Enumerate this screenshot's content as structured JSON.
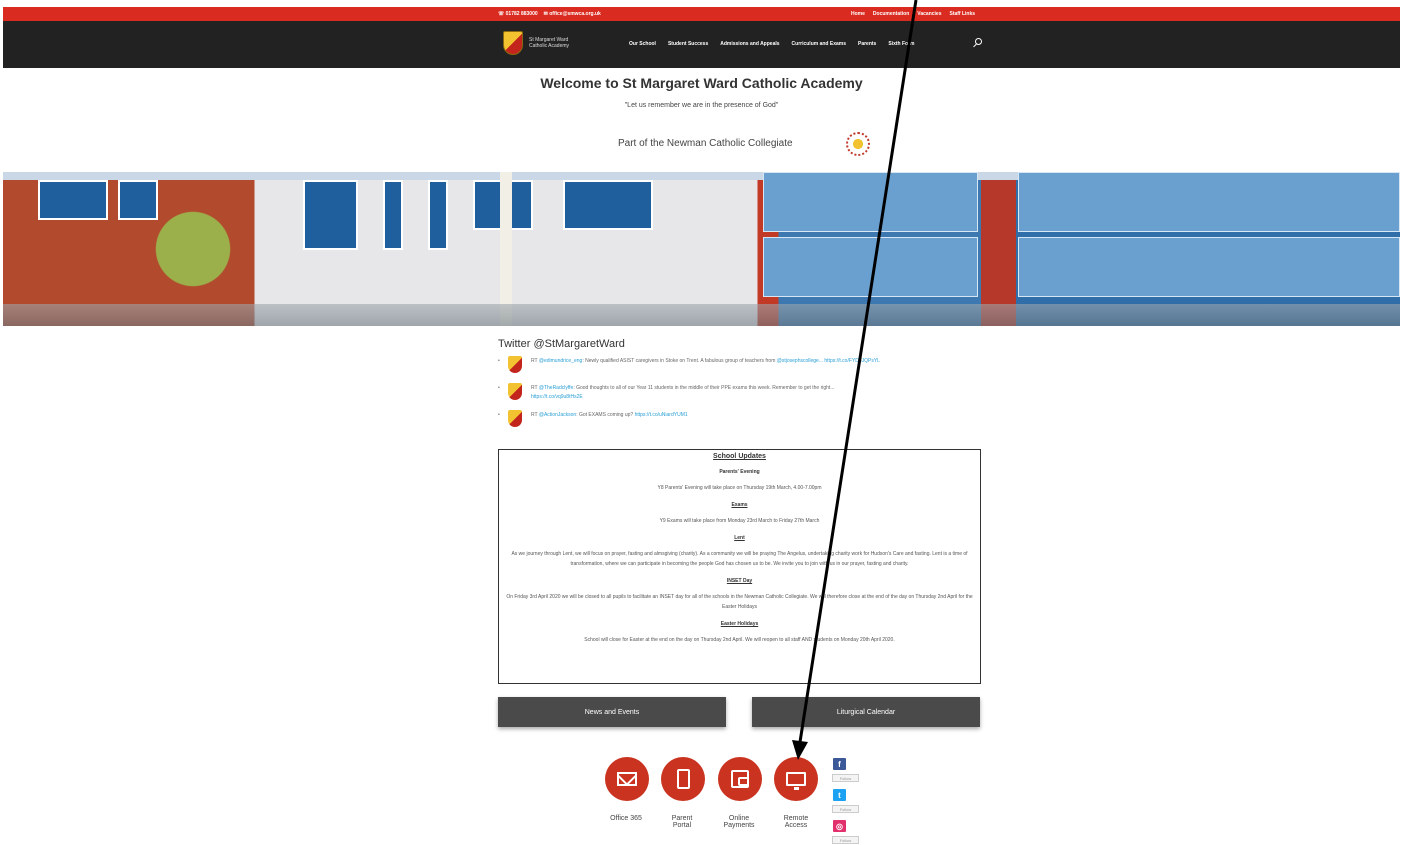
{
  "topbar": {
    "phone": "01782 883000",
    "email": "office@smwca.org.uk",
    "links": [
      "Home",
      "Documentation",
      "Vacancies",
      "Staff Links"
    ]
  },
  "nav": {
    "logo_text": "St Margaret Ward Catholic Academy",
    "items": [
      "Our School",
      "Student Success",
      "Admissions and Appeals",
      "Curriculum and Exams",
      "Parents",
      "Sixth Form"
    ]
  },
  "header": {
    "title": "Welcome to St Margaret Ward Catholic Academy",
    "motto": "\"Let us remember we are in the presence of God\"",
    "collegiate": "Part of the Newman Catholic Collegiate"
  },
  "twitter": {
    "title": "Twitter @StMargaretWard",
    "tweets": [
      {
        "prefix": "RT ",
        "handle": "@edimundrice_eng",
        "text": ": Newly qualified ASIST caregivers in Stoke on Trent. A fabulous group of teachers from ",
        "link1": "@stjosephscollege...",
        "link2": " https://t.co/FYD8JQPsYL"
      },
      {
        "prefix": "RT ",
        "handle": "@TheRadclyffe",
        "text": ": Good thoughts to all of our Year 11 students in the middle of their PPE exams this week. Remember to get the right...",
        "link1": "",
        "link2": "https://t.co/vq9u8tHs2E"
      },
      {
        "prefix": "RT ",
        "handle": "@ActionJackson",
        "text": ": Got EXAMS coming up? ",
        "link1": "",
        "link2": "https://t.co/uNiardYUM1"
      }
    ]
  },
  "updates": {
    "title": "School Updates",
    "sections": [
      {
        "heading": "Parents' Evening",
        "underline": false,
        "body": "Y8 Parents' Evening will take place on Thursday 19th March, 4.00-7.00pm"
      },
      {
        "heading": "Exams",
        "underline": true,
        "body": "Y9 Exams will take place from Monday 23rd March to Friday 27th March"
      },
      {
        "heading": "Lent",
        "underline": true,
        "body": "As we journey through Lent, we will focus on prayer, fasting and almsgiving (charity). As a community we will be praying The Angelus, undertaking charity work for Hudson's Care and fasting. Lent is a time of transformation, where we can participate in becoming the people God has chosen us to be. We invite you to join with us in our prayer, fasting and charity."
      },
      {
        "heading": "INSET Day",
        "underline": true,
        "body": "On Friday 3rd April 2020 we will be closed to all pupils to facilitate an INSET day for all of the schools in the Newman Catholic Collegiate. We will therefore close at the end of the day on Thursday 2nd April for the Easter Holidays"
      },
      {
        "heading": "Easter Holidays",
        "underline": true,
        "body": "School will close for Easter at the end on the day on Thursday 2nd April. We will reopen to all staff AND students on Monday 20th April 2020."
      }
    ]
  },
  "buttons": {
    "news": "News and Events",
    "calendar": "Liturgical Calendar"
  },
  "quicklinks": [
    {
      "label": "Office 365",
      "icon": "envelope-icon"
    },
    {
      "label": "Parent Portal",
      "icon": "tablet-icon"
    },
    {
      "label": "Online Payments",
      "icon": "wallet-icon"
    },
    {
      "label": "Remote Access",
      "icon": "monitor-icon"
    }
  ],
  "social": {
    "follow_label": "Follow",
    "facebook": "f",
    "twitter": "t",
    "instagram": "◎"
  },
  "colors": {
    "accent_red": "#c9331f",
    "topbar_red": "#d92b1f",
    "nav_dark": "#222222",
    "button_grey": "#4a4a4a",
    "facebook": "#3b5998",
    "twitter": "#1da1f2",
    "instagram": "#e1306c"
  }
}
